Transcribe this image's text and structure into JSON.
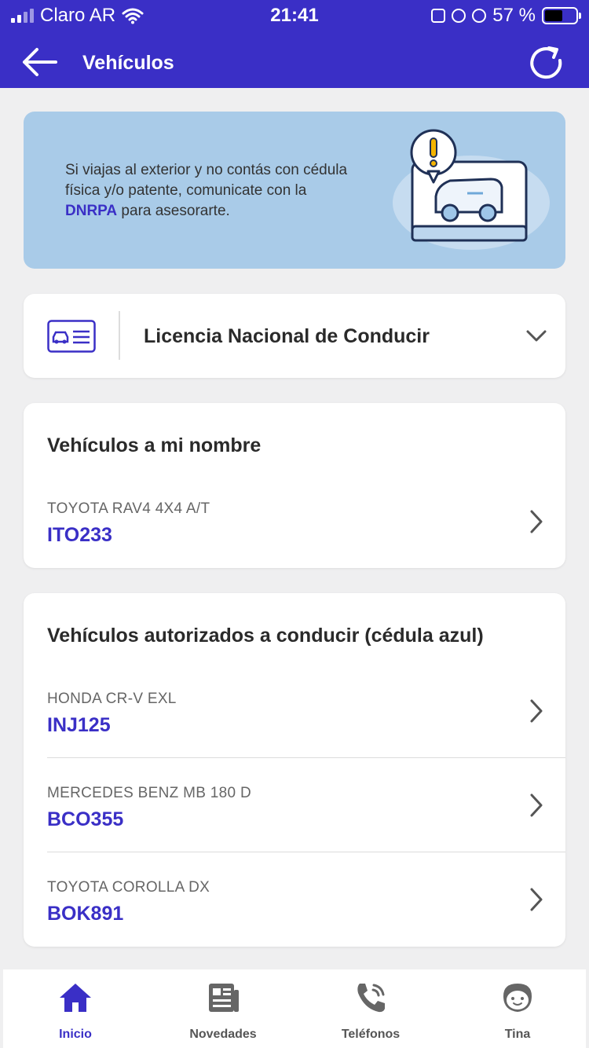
{
  "status_bar": {
    "carrier": "Claro AR",
    "time": "21:41",
    "battery": "57 %",
    "battery_level": 0.57
  },
  "header": {
    "title": "Vehículos",
    "back_icon": "arrow-left-icon",
    "refresh_icon": "refresh-icon"
  },
  "banner": {
    "text_before": "Si viajas al exterior y no contás con cédula física y/o patente, comunicate con la ",
    "link": "DNRPA",
    "text_after": " para asesorarte."
  },
  "license": {
    "title": "Licencia Nacional de Conducir"
  },
  "my_vehicles": {
    "title": "Vehículos a mi nombre",
    "items": [
      {
        "model": "TOYOTA RAV4 4X4 A/T",
        "plate": "ITO233"
      }
    ]
  },
  "authorized": {
    "title": "Vehículos autorizados a conducir (cédula azul)",
    "items": [
      {
        "model": "HONDA CR-V EXL",
        "plate": "INJ125"
      },
      {
        "model": "MERCEDES BENZ MB 180 D",
        "plate": "BCO355"
      },
      {
        "model": "TOYOTA COROLLA DX",
        "plate": "BOK891"
      }
    ]
  },
  "nav": {
    "items": [
      {
        "label": "Inicio",
        "icon": "home-icon",
        "active": true
      },
      {
        "label": "Novedades",
        "icon": "news-icon"
      },
      {
        "label": "Teléfonos",
        "icon": "phone-icon"
      },
      {
        "label": "Tina",
        "icon": "tina-avatar-icon"
      }
    ]
  },
  "colors": {
    "primary": "#3a2fc6",
    "banner_bg": "#a9cbe8",
    "page_bg": "#efeff0"
  }
}
